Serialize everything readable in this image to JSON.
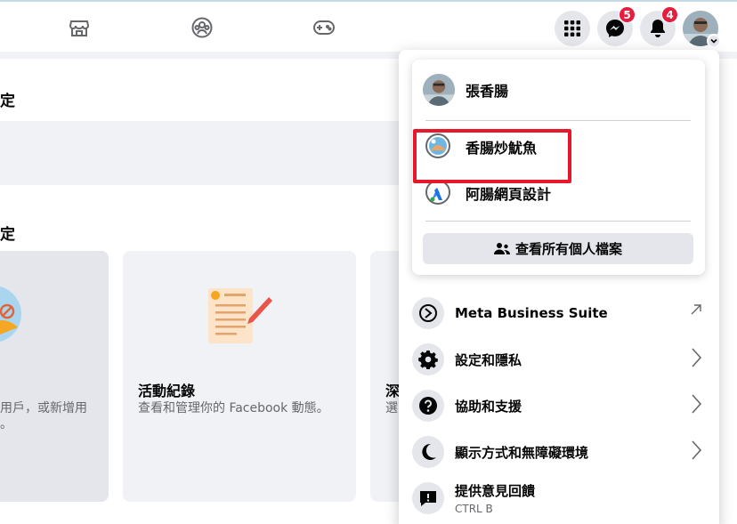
{
  "topnav": {
    "icons": [
      "marketplace-icon",
      "groups-icon",
      "gaming-icon"
    ],
    "messenger_badge": "5",
    "notifications_badge": "4"
  },
  "background": {
    "section1_title": "定",
    "section2_title": "定",
    "card1_desc_line1": "用戶，或新增用",
    "card1_desc_line2": "。",
    "card2_title": "活動紀錄",
    "card2_desc": "查看和管理你的 Facebook 動態。",
    "card3_title": "深",
    "card3_desc": "選"
  },
  "menu": {
    "profiles": [
      {
        "name": "張香腸"
      },
      {
        "name": "香腸炒魷魚"
      },
      {
        "name": "阿腸網頁設計"
      }
    ],
    "see_all_label": "查看所有個人檔案",
    "items": [
      {
        "label": "Meta Business Suite",
        "icon": "meta-business-icon",
        "arrow": "external-link-icon"
      },
      {
        "label": "設定和隱私",
        "icon": "gear-icon",
        "arrow": "chevron-right-icon"
      },
      {
        "label": "協助和支援",
        "icon": "question-icon",
        "arrow": "chevron-right-icon"
      },
      {
        "label": "顯示方式和無障礙環境",
        "icon": "moon-icon",
        "arrow": "chevron-right-icon"
      },
      {
        "label": "提供意見回饋",
        "sub": "CTRL B",
        "icon": "feedback-icon"
      }
    ]
  },
  "colors": {
    "highlight": "#e8182b",
    "badge": "#e41e3f",
    "button_bg": "#e4e6eb"
  }
}
